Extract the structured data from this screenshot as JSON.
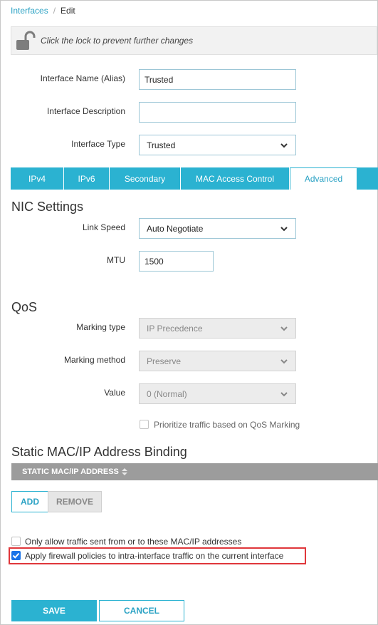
{
  "breadcrumb": {
    "parent": "Interfaces",
    "separator": "/",
    "current": "Edit"
  },
  "lockbar": {
    "text": "Click the lock to prevent further changes",
    "icon": "unlocked-padlock-icon"
  },
  "form": {
    "name_label": "Interface Name (Alias)",
    "name_value": "Trusted",
    "desc_label": "Interface Description",
    "desc_value": "",
    "type_label": "Interface Type",
    "type_value": "Trusted"
  },
  "tabs": [
    {
      "label": "IPv4",
      "active": false
    },
    {
      "label": "IPv6",
      "active": false
    },
    {
      "label": "Secondary",
      "active": false
    },
    {
      "label": "MAC Access Control",
      "active": false
    },
    {
      "label": "Advanced",
      "active": true
    }
  ],
  "nic": {
    "title": "NIC Settings",
    "link_speed_label": "Link Speed",
    "link_speed_value": "Auto Negotiate",
    "mtu_label": "MTU",
    "mtu_value": "1500"
  },
  "qos": {
    "title": "QoS",
    "marking_type_label": "Marking type",
    "marking_type_value": "IP Precedence",
    "marking_method_label": "Marking method",
    "marking_method_value": "Preserve",
    "value_label": "Value",
    "value_value": "0 (Normal)",
    "prioritize_label": "Prioritize traffic based on QoS Marking",
    "prioritize_checked": false
  },
  "binding": {
    "title": "Static MAC/IP Address Binding",
    "column_header": "STATIC MAC/IP ADDRESS",
    "sort_icon": "sort-arrows-icon",
    "add_label": "ADD",
    "remove_label": "REMOVE",
    "only_allow_label": "Only allow traffic sent from or to these MAC/IP addresses",
    "only_allow_checked": false,
    "apply_policies_label": "Apply firewall policies to intra-interface traffic on the current interface",
    "apply_policies_checked": true
  },
  "footer": {
    "save_label": "SAVE",
    "cancel_label": "CANCEL"
  },
  "colors": {
    "accent": "#2bb2d1",
    "highlight": "#e0373b",
    "checkbox": "#1a73e8"
  }
}
